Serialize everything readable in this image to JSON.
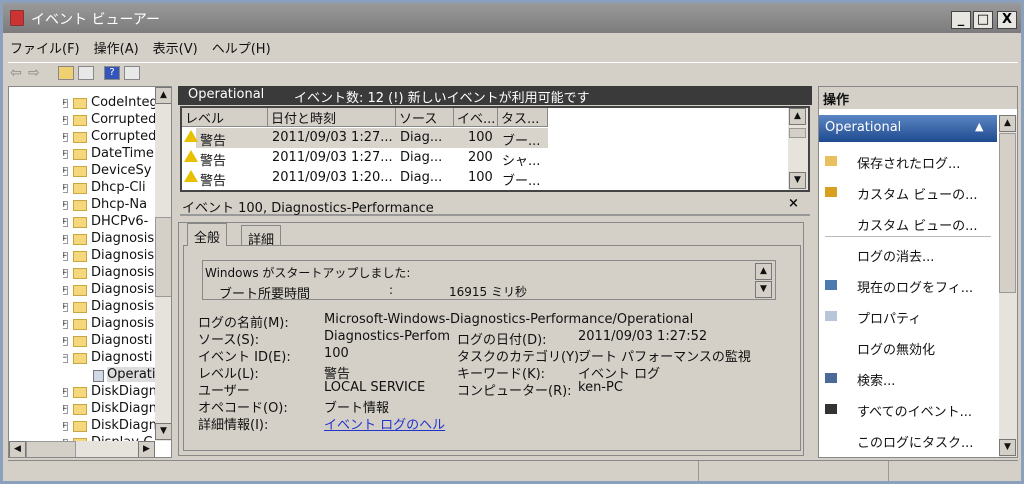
{
  "window": {
    "title": "イベント ビューアー",
    "minimize": "_",
    "maximize": "□",
    "close": "X"
  },
  "menu": [
    "ファイル(F)",
    "操作(A)",
    "表示(V)",
    "ヘルプ(H)"
  ],
  "toolbar": {
    "icons": [
      "back-icon",
      "forward-icon",
      "up-folder-icon",
      "show-tree-icon",
      "help-icon",
      "show-action-pane-icon"
    ],
    "help_glyph": "?"
  },
  "tree": {
    "items": [
      {
        "label": "CodeIntegrity",
        "expander": "+",
        "type": "folder"
      },
      {
        "label": "Corrupted",
        "expander": "+",
        "type": "folder"
      },
      {
        "label": "Corrupted",
        "expander": "+",
        "type": "folder"
      },
      {
        "label": "DateTime",
        "expander": "+",
        "type": "folder"
      },
      {
        "label": "DeviceSy",
        "expander": "+",
        "type": "folder"
      },
      {
        "label": "Dhcp-Cli",
        "expander": "+",
        "type": "folder"
      },
      {
        "label": "Dhcp-Na",
        "expander": "+",
        "type": "folder"
      },
      {
        "label": "DHCPv6-",
        "expander": "+",
        "type": "folder"
      },
      {
        "label": "Diagnosis",
        "expander": "+",
        "type": "folder"
      },
      {
        "label": "Diagnosis",
        "expander": "+",
        "type": "folder"
      },
      {
        "label": "Diagnosis",
        "expander": "+",
        "type": "folder"
      },
      {
        "label": "Diagnosis",
        "expander": "+",
        "type": "folder"
      },
      {
        "label": "Diagnosis",
        "expander": "+",
        "type": "folder"
      },
      {
        "label": "Diagnosis",
        "expander": "+",
        "type": "folder"
      },
      {
        "label": "Diagnosti",
        "expander": "+",
        "type": "folder"
      },
      {
        "label": "Diagnosti",
        "expander": "−",
        "type": "folder"
      },
      {
        "label": "Operational",
        "expander": "",
        "type": "log",
        "selected": true
      },
      {
        "label": "DiskDiagn",
        "expander": "+",
        "type": "folder"
      },
      {
        "label": "DiskDiagn",
        "expander": "+",
        "type": "folder"
      },
      {
        "label": "DiskDiagn",
        "expander": "+",
        "type": "folder"
      },
      {
        "label": "Display-C",
        "expander": "+",
        "type": "folder"
      }
    ]
  },
  "log": {
    "name": "Operational",
    "summary": "イベント数: 12 (!) 新しいイベントが利用可能です",
    "columns": [
      "レベル",
      "日付と時刻",
      "ソース",
      "イベ...",
      "タス..."
    ],
    "rows": [
      {
        "level": "警告",
        "date": "2011/09/03 1:27...",
        "source": "Diag...",
        "id": "100",
        "task": "ブー..."
      },
      {
        "level": "警告",
        "date": "2011/09/03 1:27...",
        "source": "Diag...",
        "id": "200",
        "task": "シャ..."
      },
      {
        "level": "警告",
        "date": "2011/09/03 1:20...",
        "source": "Diag...",
        "id": "100",
        "task": "ブー..."
      }
    ]
  },
  "detail": {
    "title": "イベント 100, Diagnostics-Performance",
    "close": "×",
    "tabs": [
      "全般",
      "詳細"
    ],
    "message_line1": "Windows がスタートアップしました:",
    "message_label": "ブート所要時間",
    "message_sep": ":",
    "message_value": "16915 ミリ秒",
    "fields": {
      "log_name_label": "ログの名前(M):",
      "log_name": "Microsoft-Windows-Diagnostics-Performance/Operational",
      "source_label": "ソース(S):",
      "source": "Diagnostics-Perfom",
      "logged_label": "ログの日付(D):",
      "logged": "2011/09/03 1:27:52",
      "event_id_label": "イベント ID(E):",
      "event_id": "100",
      "task_label": "タスクのカテゴリ(Y):",
      "task": "ブート パフォーマンスの監視",
      "level_label": "レベル(L):",
      "level": "警告",
      "keywords_label": "キーワード(K):",
      "keywords": "イベント ログ",
      "user_label": "ユーザー",
      "user": "LOCAL SERVICE",
      "computer_label": "コンピューター(R):",
      "computer": "ken-PC",
      "opcode_label": "オペコード(O):",
      "opcode": "ブート情報",
      "more_info_label": "詳細情報(I):",
      "more_info_link": "イベント ログのヘル"
    }
  },
  "actions": {
    "title": "操作",
    "section": "Operational",
    "items": [
      {
        "label": "保存されたログ...",
        "icon": "open-folder-icon"
      },
      {
        "label": "カスタム ビューの...",
        "icon": "filter-icon"
      },
      {
        "label": "カスタム ビューの...",
        "icon": ""
      },
      {
        "label": "ログの消去...",
        "icon": ""
      },
      {
        "label": "現在のログをフィ...",
        "icon": "filter-icon"
      },
      {
        "label": "プロパティ",
        "icon": "properties-icon"
      },
      {
        "label": "ログの無効化",
        "icon": ""
      },
      {
        "label": "検索...",
        "icon": "binoculars-icon"
      },
      {
        "label": "すべてのイベント...",
        "icon": "save-icon"
      },
      {
        "label": "このログにタスク...",
        "icon": ""
      }
    ]
  },
  "colors": {
    "accent": "#1e4a8f",
    "header_dark": "#3a3a3a",
    "link": "#2233cc",
    "warning": "#e8c000"
  }
}
